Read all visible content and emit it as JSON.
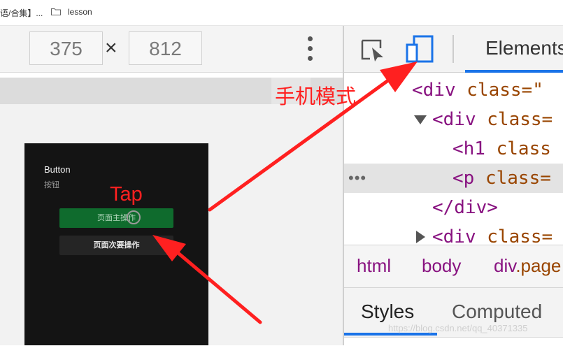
{
  "bookmarks": {
    "item1_label": "语/合集】...",
    "item2_label": "lesson"
  },
  "device_toolbar": {
    "width": "375",
    "times": "×",
    "height": "812"
  },
  "phone": {
    "title": "Button",
    "subtitle": "按钮",
    "primary_button": "页面主操作",
    "secondary_button": "页面次要操作"
  },
  "annotations": {
    "tap": "Tap",
    "device_mode": "手机模式",
    "color": "#ff2020"
  },
  "devtools": {
    "tabs": {
      "elements": "Elements"
    },
    "dom": {
      "line1": {
        "open": "<div",
        "attr": "class=\""
      },
      "line2": {
        "open": "<div",
        "attr": "class="
      },
      "line3": {
        "open": "<h1",
        "attr": "class"
      },
      "line4": {
        "dots": "•••",
        "open": "<p",
        "attr": "class="
      },
      "line5": {
        "close": "</div>"
      },
      "line6": {
        "open": "<div",
        "attr": "class="
      }
    },
    "breadcrumbs": {
      "c1": "html",
      "c2": "body",
      "c3_tag": "div",
      "c3_class": ".page"
    },
    "bottom_tabs": {
      "styles": "Styles",
      "computed": "Computed"
    },
    "watermark": "https://blog.csdn.net/qq_40371335"
  },
  "icons": {
    "inspect": "inspect-element-icon",
    "device": "device-toolbar-icon",
    "kebab": "more-options-icon",
    "folder": "folder-icon"
  },
  "colors": {
    "accent": "#1a73e8",
    "tag": "#881280",
    "attr": "#994500",
    "primary_button": "#0f6b2d"
  }
}
